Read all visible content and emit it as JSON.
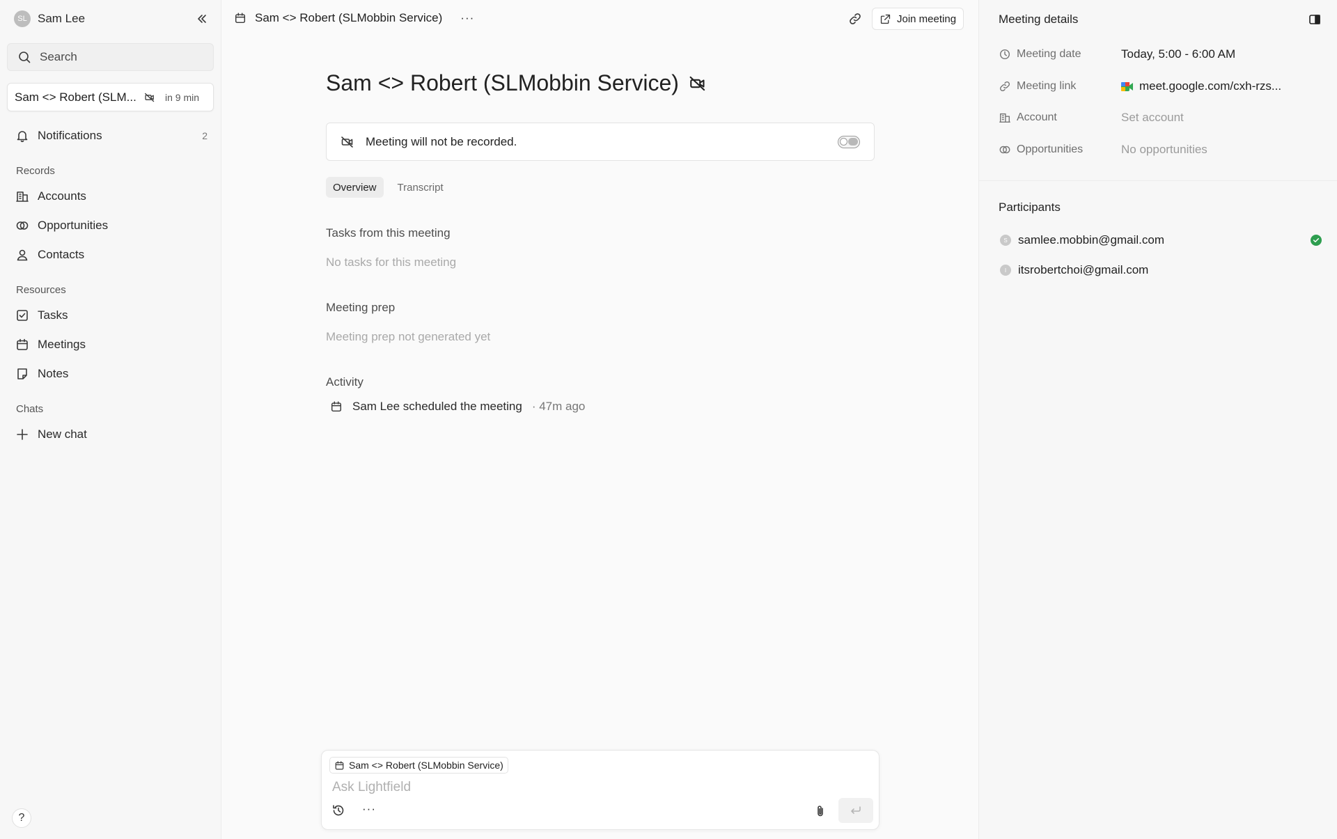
{
  "sidebar": {
    "user": {
      "initials": "SL",
      "name": "Sam Lee"
    },
    "search_label": "Search",
    "current_meeting": {
      "title": "Sam <> Robert (SLM...",
      "when": "in 9 min"
    },
    "notifications": {
      "label": "Notifications",
      "count": "2"
    },
    "records_label": "Records",
    "records": [
      {
        "label": "Accounts"
      },
      {
        "label": "Opportunities"
      },
      {
        "label": "Contacts"
      }
    ],
    "resources_label": "Resources",
    "resources": [
      {
        "label": "Tasks"
      },
      {
        "label": "Meetings"
      },
      {
        "label": "Notes"
      }
    ],
    "chats_label": "Chats",
    "new_chat_label": "New chat",
    "help_label": "?"
  },
  "topbar": {
    "title": "Sam <> Robert (SLMobbin Service)",
    "more": "···",
    "join_label": "Join meeting"
  },
  "main": {
    "title": "Sam <> Robert (SLMobbin Service)",
    "record_notice": "Meeting will not be recorded.",
    "tabs": [
      {
        "label": "Overview"
      },
      {
        "label": "Transcript"
      }
    ],
    "tasks_heading": "Tasks from this meeting",
    "tasks_empty": "No tasks for this meeting",
    "prep_heading": "Meeting prep",
    "prep_empty": "Meeting prep not generated yet",
    "activity_heading": "Activity",
    "activity": {
      "text": "Sam Lee scheduled the meeting",
      "ago": "· 47m ago"
    }
  },
  "composer": {
    "context_chip": "Sam <> Robert (SLMobbin Service)",
    "placeholder": "Ask Lightfield",
    "more": "···"
  },
  "details": {
    "title": "Meeting details",
    "date_label": "Meeting date",
    "date_value": "Today, 5:00 - 6:00 AM",
    "link_label": "Meeting link",
    "link_value": "meet.google.com/cxh-rzs...",
    "account_label": "Account",
    "account_value": "Set account",
    "opps_label": "Opportunities",
    "opps_value": "No opportunities",
    "participants_title": "Participants",
    "participants": [
      {
        "initial": "S",
        "email": "samlee.mobbin@gmail.com",
        "accepted": true
      },
      {
        "initial": "I",
        "email": "itsrobertchoi@gmail.com",
        "accepted": false
      }
    ]
  },
  "colors": {
    "accepted_green": "#2e9e4f",
    "accent_text": "#1f1f1f",
    "muted_text": "#a9a9a9"
  }
}
